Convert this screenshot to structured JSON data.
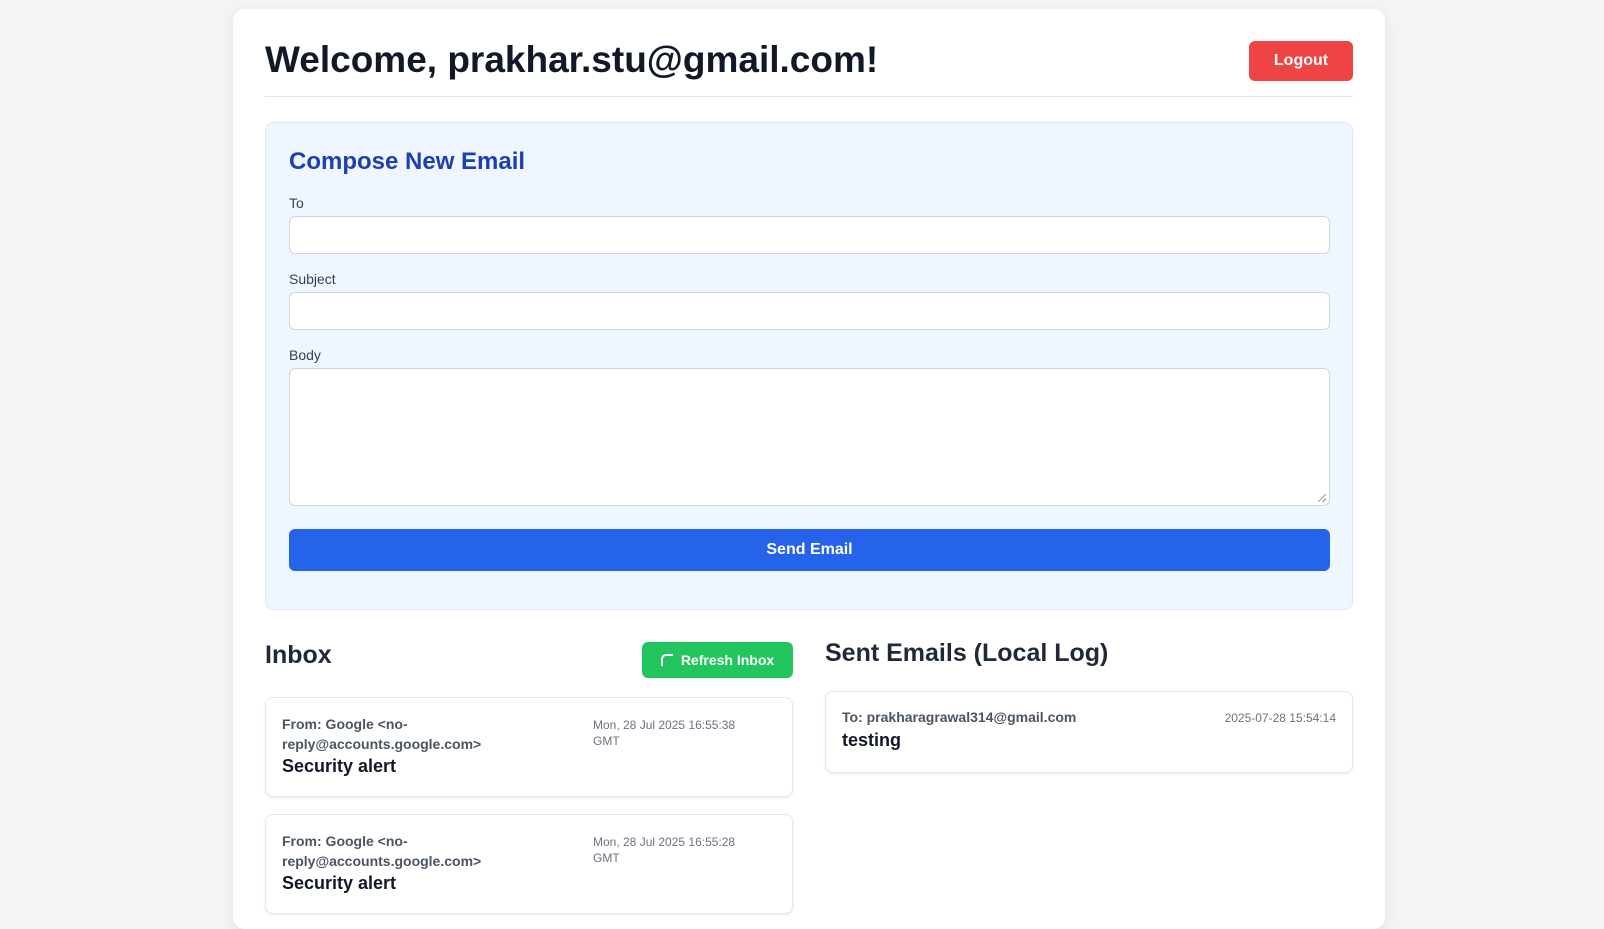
{
  "header": {
    "welcome": "Welcome, prakhar.stu@gmail.com!",
    "logout_label": "Logout"
  },
  "compose": {
    "title": "Compose New Email",
    "to_label": "To",
    "to_value": "",
    "subject_label": "Subject",
    "subject_value": "",
    "body_label": "Body",
    "body_value": "",
    "send_label": "Send Email"
  },
  "inbox": {
    "title": "Inbox",
    "refresh_label": "Refresh Inbox",
    "refresh_icon": "refresh-icon",
    "items": [
      {
        "from": "From: Google <no-reply@accounts.google.com>",
        "date": "Mon, 28 Jul 2025 16:55:38 GMT",
        "subject": "Security alert"
      },
      {
        "from": "From: Google <no-reply@accounts.google.com>",
        "date": "Mon, 28 Jul 2025 16:55:28 GMT",
        "subject": "Security alert"
      }
    ]
  },
  "sent": {
    "title": "Sent Emails (Local Log)",
    "items": [
      {
        "to": "To: prakharagrawal314@gmail.com",
        "date": "2025-07-28 15:54:14",
        "subject": "testing"
      }
    ]
  },
  "colors": {
    "logout": "#ef4444",
    "send": "#2563eb",
    "refresh": "#22c55e",
    "compose_bg": "#eff6ff",
    "compose_title": "#1e40af"
  }
}
